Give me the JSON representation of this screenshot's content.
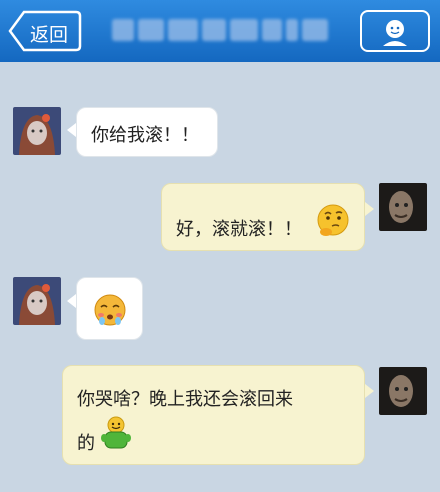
{
  "header": {
    "back_label": "返回",
    "contact_name": "████████",
    "colors": {
      "bar_top": "#2f8be0",
      "bar_bottom": "#1468c0"
    },
    "profile_icon": "person-icon"
  },
  "messages": [
    {
      "side": "in",
      "text": "你给我滚！！"
    },
    {
      "side": "out",
      "text": "好，滚就滚！！",
      "emoji": "thinking-face-icon"
    },
    {
      "side": "in",
      "text": "",
      "emoji": "crying-face-icon"
    },
    {
      "side": "out",
      "line1": "你哭啥？晚上我还会滚回来",
      "line2": "的",
      "emoji": "green-smiley-icon"
    }
  ],
  "colors": {
    "background": "#c9d6e3",
    "incoming_bubble": "#ffffff",
    "outgoing_bubble": "#f7f3d0"
  }
}
